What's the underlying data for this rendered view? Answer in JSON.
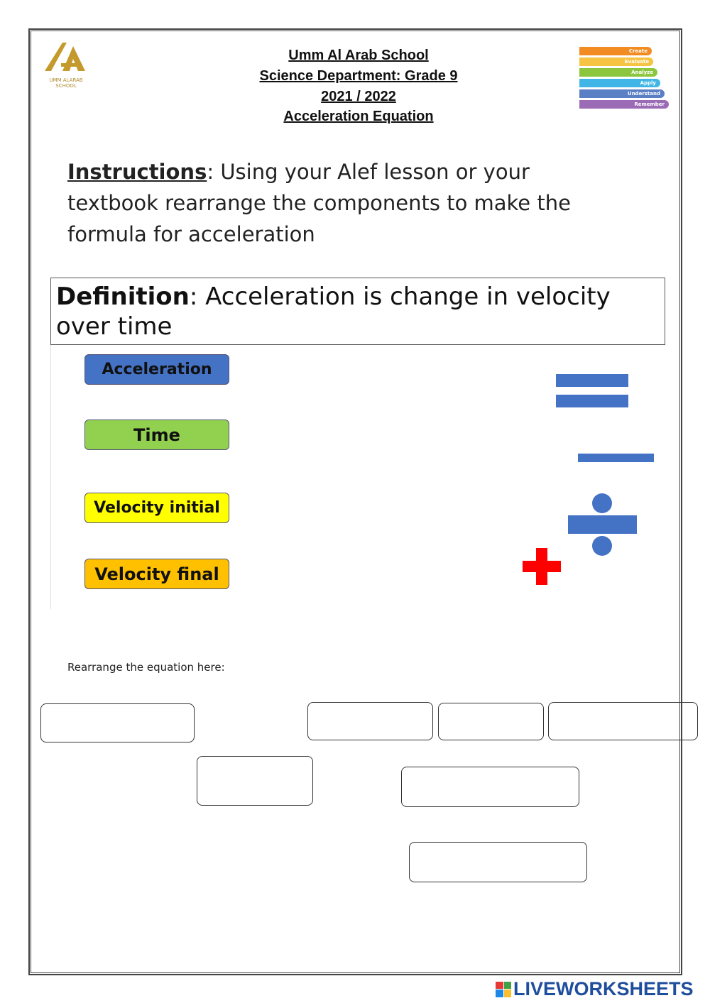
{
  "header": {
    "school": "Umm Al Arab School",
    "department": "Science Department: Grade 9",
    "year": "2021 / 2022",
    "topic": "Acceleration Equation"
  },
  "logo": {
    "text": "UMM ALARAB SCHOOL",
    "color": "#c49a2c"
  },
  "bloom": {
    "levels": [
      "Create",
      "Evaluate",
      "Analyze",
      "Apply",
      "Understand",
      "Remember"
    ],
    "colors": [
      "#f28b22",
      "#f6c342",
      "#8cc63f",
      "#41b6e6",
      "#5b7fc4",
      "#9b6bb5"
    ]
  },
  "instructions": {
    "label": "Instructions",
    "text": ": Using your Alef lesson or your textbook rearrange the components to make the formula for acceleration"
  },
  "definition": {
    "label": "Definition",
    "text": ": Acceleration is change in velocity over time"
  },
  "components": [
    {
      "label": "Acceleration",
      "color": "#4472c4"
    },
    {
      "label": "Time",
      "color": "#92d050"
    },
    {
      "label": "Velocity initial",
      "color": "#ffff00"
    },
    {
      "label": "Velocity final",
      "color": "#ffc000"
    }
  ],
  "symbols": {
    "equals": "equals",
    "minus": "minus",
    "divide": "divide",
    "plus": "plus",
    "blue": "#4472c4",
    "red": "#ff0000"
  },
  "rearrange_label": "Rearrange the equation here:",
  "footer": {
    "brand": "LIVEWORKSHEETS",
    "color": "#1f4e9c"
  }
}
